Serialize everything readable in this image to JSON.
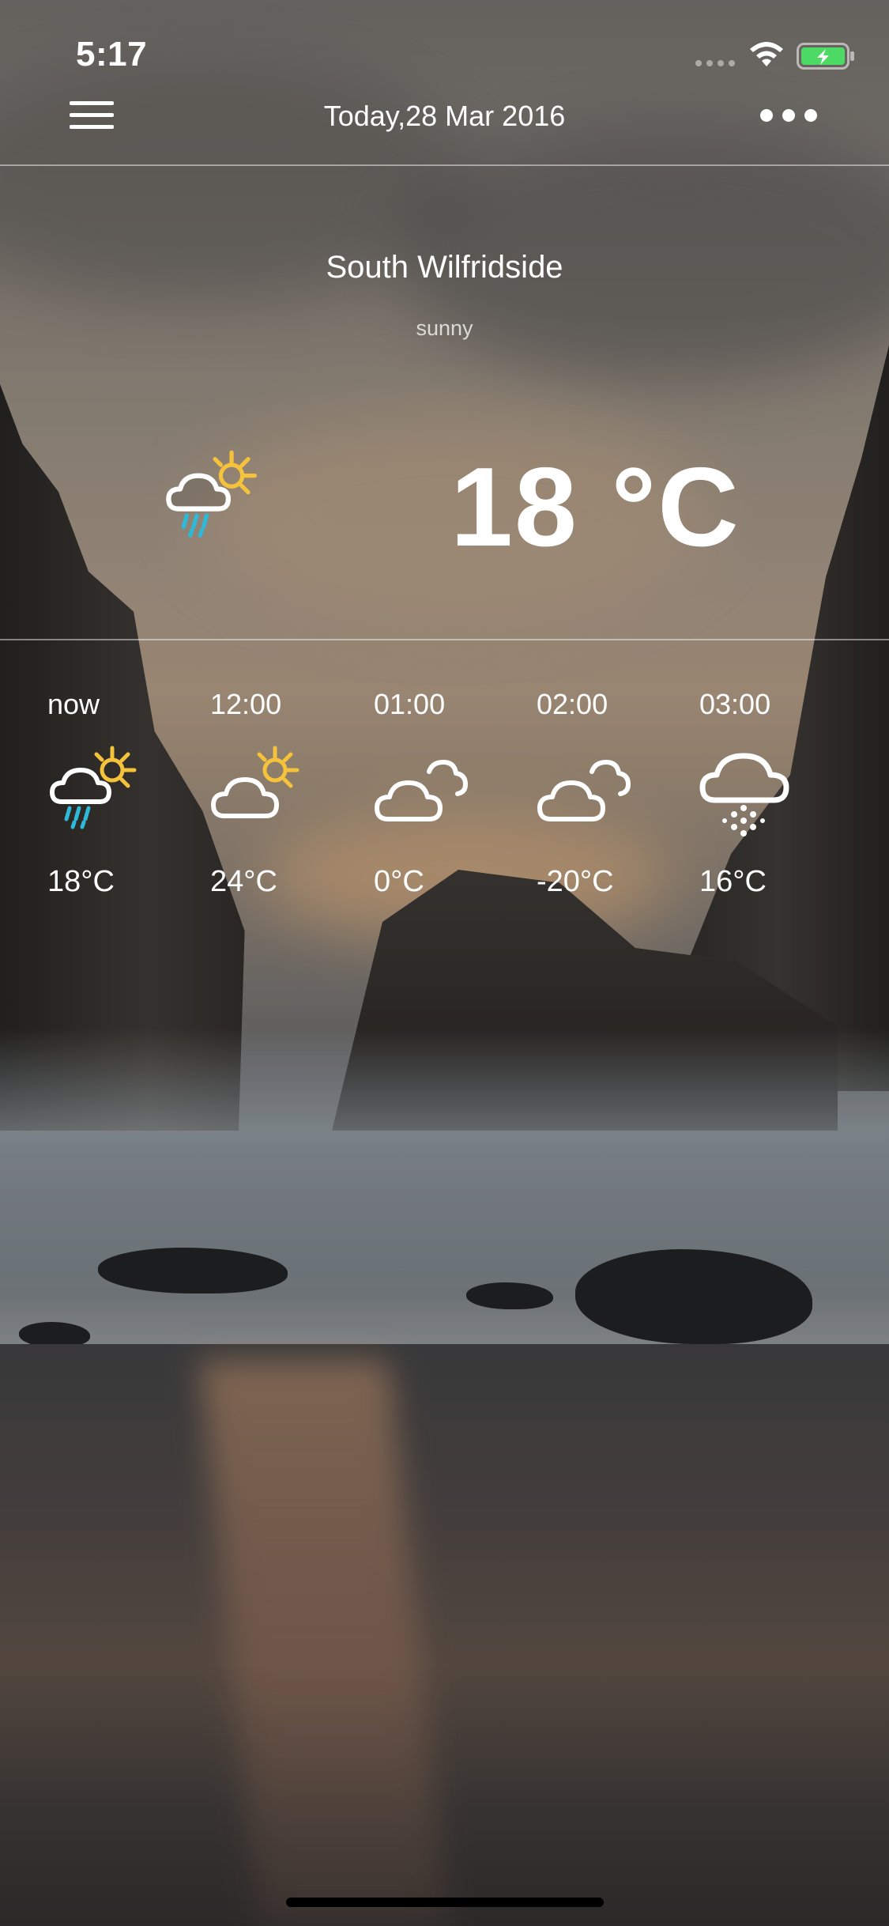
{
  "status_bar": {
    "time": "5:17"
  },
  "nav": {
    "title": "Today,28 Mar 2016"
  },
  "current": {
    "city": "South Wilfridside",
    "condition": "sunny",
    "temperature": "18 °C",
    "icon": "rain-sun-icon"
  },
  "hourly": [
    {
      "label": "now",
      "temp": "18°C",
      "icon": "rain-sun-icon"
    },
    {
      "label": "12:00",
      "temp": "24°C",
      "icon": "cloud-sun-icon"
    },
    {
      "label": "01:00",
      "temp": "0°C",
      "icon": "clouds-icon"
    },
    {
      "label": "02:00",
      "temp": "-20°C",
      "icon": "clouds-icon"
    },
    {
      "label": "03:00",
      "temp": "16°C",
      "icon": "snow-cloud-icon"
    }
  ],
  "colors": {
    "sun": "#F5C33B",
    "rain": "#2FB9D8",
    "battery": "#4CD964"
  }
}
